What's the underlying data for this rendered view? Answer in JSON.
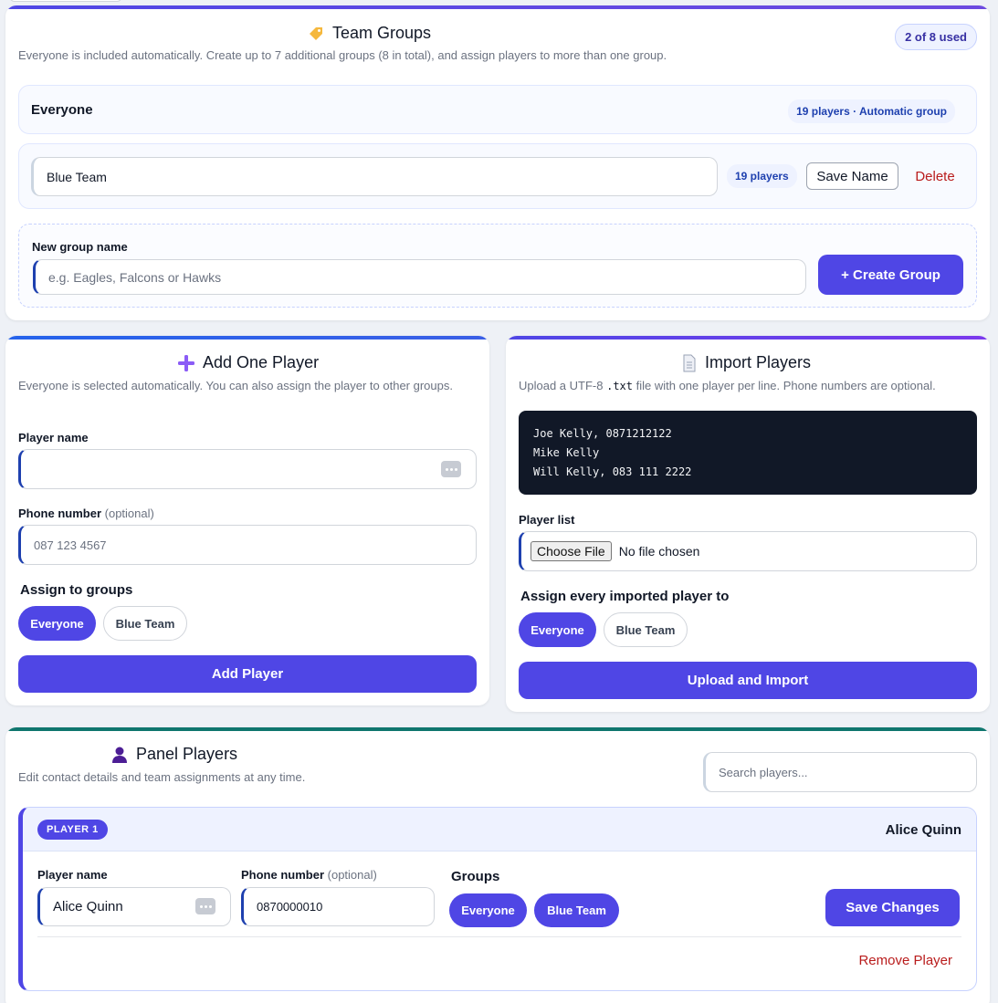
{
  "team_groups": {
    "title": "Team Groups",
    "subtitle": "Everyone is included automatically. Create up to 7 additional groups (8 in total), and assign players to more than one group.",
    "used_badge": "2 of 8 used",
    "everyone": {
      "name": "Everyone",
      "badge": "19 players · Automatic group"
    },
    "groups": [
      {
        "name": "Blue Team",
        "count": "19 players",
        "save_label": "Save Name",
        "delete_label": "Delete"
      }
    ],
    "new_group": {
      "label": "New group name",
      "placeholder": "e.g. Eagles, Falcons or Hawks",
      "button": "+ Create Group"
    }
  },
  "add_player": {
    "title": "Add One Player",
    "subtitle": "Everyone is selected automatically. You can also assign the player to other groups.",
    "name_label": "Player name",
    "name_value": "",
    "phone_label": "Phone number",
    "optional": "(optional)",
    "phone_placeholder": "087 123 4567",
    "assign_label": "Assign to groups",
    "groups": [
      {
        "name": "Everyone",
        "selected": true
      },
      {
        "name": "Blue Team",
        "selected": false
      }
    ],
    "button": "Add Player"
  },
  "import_players": {
    "title": "Import Players",
    "subtitle_before": "Upload a UTF-8 ",
    "subtitle_code": ".txt",
    "subtitle_after": " file with one player per line. Phone numbers are optional.",
    "example_lines": [
      "Joe Kelly, 0871212122",
      "Mike Kelly",
      "Will Kelly, 083 111 2222"
    ],
    "list_label": "Player list",
    "choose_file": "Choose File",
    "no_file": "No file chosen",
    "assign_label": "Assign every imported player to",
    "groups": [
      {
        "name": "Everyone",
        "selected": true
      },
      {
        "name": "Blue Team",
        "selected": false
      }
    ],
    "button": "Upload and Import"
  },
  "panel_players": {
    "title": "Panel Players",
    "subtitle": "Edit contact details and team assignments at any time.",
    "search_placeholder": "Search players...",
    "players": [
      {
        "tag": "PLAYER 1",
        "name": "Alice Quinn",
        "name_label": "Player name",
        "phone_label": "Phone number",
        "optional": "(optional)",
        "phone": "0870000010",
        "groups_label": "Groups",
        "groups": [
          "Everyone",
          "Blue Team"
        ],
        "save_label": "Save Changes",
        "remove_label": "Remove Player"
      }
    ]
  }
}
